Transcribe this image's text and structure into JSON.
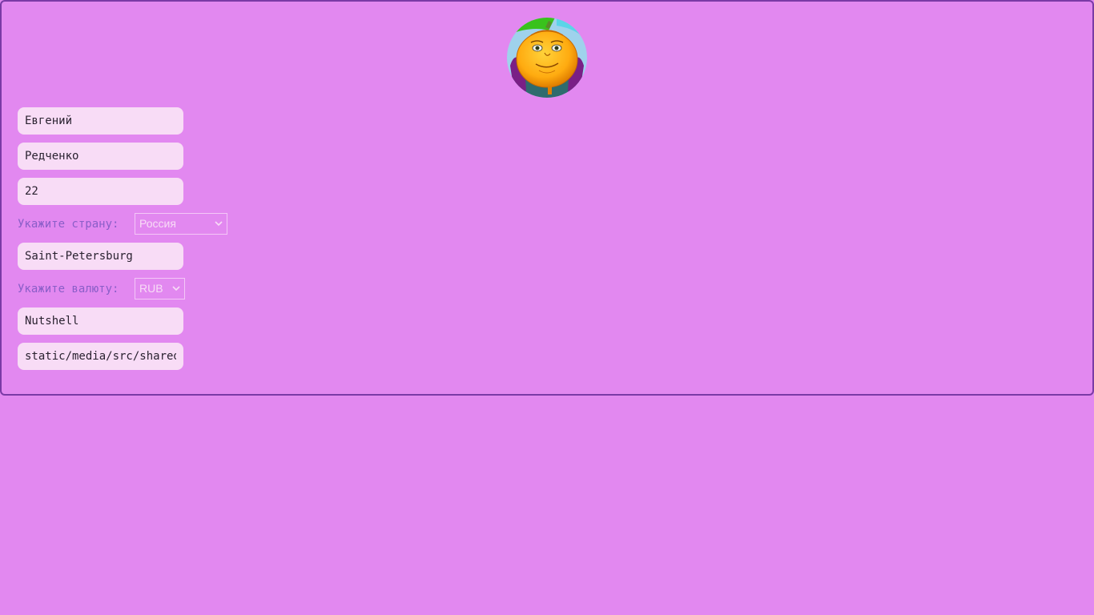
{
  "profile": {
    "first_name": "Евгений",
    "last_name": "Редченко",
    "age": "22",
    "country_label": "Укажите страну:",
    "country_value": "Россия",
    "city": "Saint-Petersburg",
    "currency_label": "Укажите валюту:",
    "currency_value": "RUB",
    "nickname": "Nutshell",
    "avatar_path": "static/media/src/shared"
  },
  "icons": {
    "avatar": "pumpkin-character-avatar",
    "select_arrow": "chevron-down-icon"
  },
  "colors": {
    "background": "#e288f0",
    "border": "#7a3aa6",
    "field_bg": "#f8dcf6",
    "label": "#8a5ec8"
  }
}
